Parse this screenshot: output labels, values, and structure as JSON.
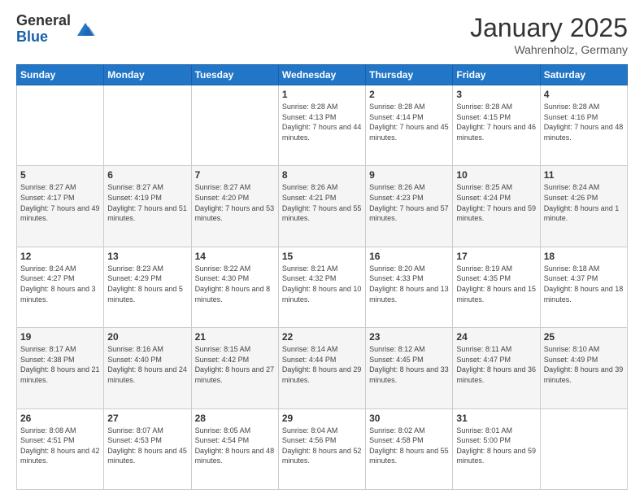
{
  "header": {
    "logo_general": "General",
    "logo_blue": "Blue",
    "month_title": "January 2025",
    "location": "Wahrenholz, Germany"
  },
  "weekdays": [
    "Sunday",
    "Monday",
    "Tuesday",
    "Wednesday",
    "Thursday",
    "Friday",
    "Saturday"
  ],
  "weeks": [
    [
      {
        "day": "",
        "sunrise": "",
        "sunset": "",
        "daylight": ""
      },
      {
        "day": "",
        "sunrise": "",
        "sunset": "",
        "daylight": ""
      },
      {
        "day": "",
        "sunrise": "",
        "sunset": "",
        "daylight": ""
      },
      {
        "day": "1",
        "sunrise": "Sunrise: 8:28 AM",
        "sunset": "Sunset: 4:13 PM",
        "daylight": "Daylight: 7 hours and 44 minutes."
      },
      {
        "day": "2",
        "sunrise": "Sunrise: 8:28 AM",
        "sunset": "Sunset: 4:14 PM",
        "daylight": "Daylight: 7 hours and 45 minutes."
      },
      {
        "day": "3",
        "sunrise": "Sunrise: 8:28 AM",
        "sunset": "Sunset: 4:15 PM",
        "daylight": "Daylight: 7 hours and 46 minutes."
      },
      {
        "day": "4",
        "sunrise": "Sunrise: 8:28 AM",
        "sunset": "Sunset: 4:16 PM",
        "daylight": "Daylight: 7 hours and 48 minutes."
      }
    ],
    [
      {
        "day": "5",
        "sunrise": "Sunrise: 8:27 AM",
        "sunset": "Sunset: 4:17 PM",
        "daylight": "Daylight: 7 hours and 49 minutes."
      },
      {
        "day": "6",
        "sunrise": "Sunrise: 8:27 AM",
        "sunset": "Sunset: 4:19 PM",
        "daylight": "Daylight: 7 hours and 51 minutes."
      },
      {
        "day": "7",
        "sunrise": "Sunrise: 8:27 AM",
        "sunset": "Sunset: 4:20 PM",
        "daylight": "Daylight: 7 hours and 53 minutes."
      },
      {
        "day": "8",
        "sunrise": "Sunrise: 8:26 AM",
        "sunset": "Sunset: 4:21 PM",
        "daylight": "Daylight: 7 hours and 55 minutes."
      },
      {
        "day": "9",
        "sunrise": "Sunrise: 8:26 AM",
        "sunset": "Sunset: 4:23 PM",
        "daylight": "Daylight: 7 hours and 57 minutes."
      },
      {
        "day": "10",
        "sunrise": "Sunrise: 8:25 AM",
        "sunset": "Sunset: 4:24 PM",
        "daylight": "Daylight: 7 hours and 59 minutes."
      },
      {
        "day": "11",
        "sunrise": "Sunrise: 8:24 AM",
        "sunset": "Sunset: 4:26 PM",
        "daylight": "Daylight: 8 hours and 1 minute."
      }
    ],
    [
      {
        "day": "12",
        "sunrise": "Sunrise: 8:24 AM",
        "sunset": "Sunset: 4:27 PM",
        "daylight": "Daylight: 8 hours and 3 minutes."
      },
      {
        "day": "13",
        "sunrise": "Sunrise: 8:23 AM",
        "sunset": "Sunset: 4:29 PM",
        "daylight": "Daylight: 8 hours and 5 minutes."
      },
      {
        "day": "14",
        "sunrise": "Sunrise: 8:22 AM",
        "sunset": "Sunset: 4:30 PM",
        "daylight": "Daylight: 8 hours and 8 minutes."
      },
      {
        "day": "15",
        "sunrise": "Sunrise: 8:21 AM",
        "sunset": "Sunset: 4:32 PM",
        "daylight": "Daylight: 8 hours and 10 minutes."
      },
      {
        "day": "16",
        "sunrise": "Sunrise: 8:20 AM",
        "sunset": "Sunset: 4:33 PM",
        "daylight": "Daylight: 8 hours and 13 minutes."
      },
      {
        "day": "17",
        "sunrise": "Sunrise: 8:19 AM",
        "sunset": "Sunset: 4:35 PM",
        "daylight": "Daylight: 8 hours and 15 minutes."
      },
      {
        "day": "18",
        "sunrise": "Sunrise: 8:18 AM",
        "sunset": "Sunset: 4:37 PM",
        "daylight": "Daylight: 8 hours and 18 minutes."
      }
    ],
    [
      {
        "day": "19",
        "sunrise": "Sunrise: 8:17 AM",
        "sunset": "Sunset: 4:38 PM",
        "daylight": "Daylight: 8 hours and 21 minutes."
      },
      {
        "day": "20",
        "sunrise": "Sunrise: 8:16 AM",
        "sunset": "Sunset: 4:40 PM",
        "daylight": "Daylight: 8 hours and 24 minutes."
      },
      {
        "day": "21",
        "sunrise": "Sunrise: 8:15 AM",
        "sunset": "Sunset: 4:42 PM",
        "daylight": "Daylight: 8 hours and 27 minutes."
      },
      {
        "day": "22",
        "sunrise": "Sunrise: 8:14 AM",
        "sunset": "Sunset: 4:44 PM",
        "daylight": "Daylight: 8 hours and 29 minutes."
      },
      {
        "day": "23",
        "sunrise": "Sunrise: 8:12 AM",
        "sunset": "Sunset: 4:45 PM",
        "daylight": "Daylight: 8 hours and 33 minutes."
      },
      {
        "day": "24",
        "sunrise": "Sunrise: 8:11 AM",
        "sunset": "Sunset: 4:47 PM",
        "daylight": "Daylight: 8 hours and 36 minutes."
      },
      {
        "day": "25",
        "sunrise": "Sunrise: 8:10 AM",
        "sunset": "Sunset: 4:49 PM",
        "daylight": "Daylight: 8 hours and 39 minutes."
      }
    ],
    [
      {
        "day": "26",
        "sunrise": "Sunrise: 8:08 AM",
        "sunset": "Sunset: 4:51 PM",
        "daylight": "Daylight: 8 hours and 42 minutes."
      },
      {
        "day": "27",
        "sunrise": "Sunrise: 8:07 AM",
        "sunset": "Sunset: 4:53 PM",
        "daylight": "Daylight: 8 hours and 45 minutes."
      },
      {
        "day": "28",
        "sunrise": "Sunrise: 8:05 AM",
        "sunset": "Sunset: 4:54 PM",
        "daylight": "Daylight: 8 hours and 48 minutes."
      },
      {
        "day": "29",
        "sunrise": "Sunrise: 8:04 AM",
        "sunset": "Sunset: 4:56 PM",
        "daylight": "Daylight: 8 hours and 52 minutes."
      },
      {
        "day": "30",
        "sunrise": "Sunrise: 8:02 AM",
        "sunset": "Sunset: 4:58 PM",
        "daylight": "Daylight: 8 hours and 55 minutes."
      },
      {
        "day": "31",
        "sunrise": "Sunrise: 8:01 AM",
        "sunset": "Sunset: 5:00 PM",
        "daylight": "Daylight: 8 hours and 59 minutes."
      },
      {
        "day": "",
        "sunrise": "",
        "sunset": "",
        "daylight": ""
      }
    ]
  ]
}
